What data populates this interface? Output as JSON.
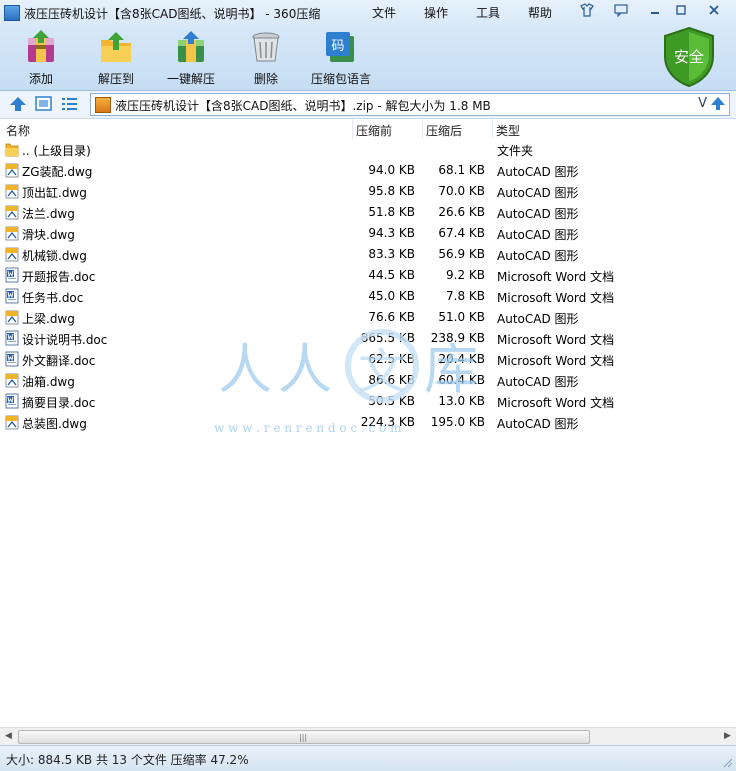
{
  "window": {
    "title": "液压压砖机设计【含8张CAD图纸、说明书】 - 360压缩",
    "menus": [
      "文件",
      "操作",
      "工具",
      "帮助"
    ]
  },
  "toolbar": {
    "items": [
      {
        "label": "添加",
        "icon": "add-archive-icon"
      },
      {
        "label": "解压到",
        "icon": "extract-to-icon"
      },
      {
        "label": "一键解压",
        "icon": "one-click-extract-icon"
      },
      {
        "label": "删除",
        "icon": "delete-icon"
      },
      {
        "label": "压缩包语言",
        "icon": "archive-language-icon",
        "badge": "码"
      }
    ],
    "security_badge": "安全"
  },
  "address": {
    "path": "液压压砖机设计【含8张CAD图纸、说明书】.zip - 解包大小为 1.8 MB",
    "dropdown_glyph": "V"
  },
  "list": {
    "headers": {
      "name": "名称",
      "size": "压缩前",
      "packed": "压缩后",
      "type": "类型"
    },
    "rows": [
      {
        "name": ".. (上级目录)",
        "size": "",
        "packed": "",
        "type": "文件夹",
        "icon": "folder"
      },
      {
        "name": "ZG装配.dwg",
        "size": "94.0 KB",
        "packed": "68.1 KB",
        "type": "AutoCAD 图形",
        "icon": "dwg"
      },
      {
        "name": "顶出缸.dwg",
        "size": "95.8 KB",
        "packed": "70.0 KB",
        "type": "AutoCAD 图形",
        "icon": "dwg"
      },
      {
        "name": "法兰.dwg",
        "size": "51.8 KB",
        "packed": "26.6 KB",
        "type": "AutoCAD 图形",
        "icon": "dwg"
      },
      {
        "name": "滑块.dwg",
        "size": "94.3 KB",
        "packed": "67.4 KB",
        "type": "AutoCAD 图形",
        "icon": "dwg"
      },
      {
        "name": "机械锁.dwg",
        "size": "83.3 KB",
        "packed": "56.9 KB",
        "type": "AutoCAD 图形",
        "icon": "dwg"
      },
      {
        "name": "开题报告.doc",
        "size": "44.5 KB",
        "packed": "9.2 KB",
        "type": "Microsoft Word 文档",
        "icon": "doc"
      },
      {
        "name": "任务书.doc",
        "size": "45.0 KB",
        "packed": "7.8 KB",
        "type": "Microsoft Word 文档",
        "icon": "doc"
      },
      {
        "name": "上梁.dwg",
        "size": "76.6 KB",
        "packed": "51.0 KB",
        "type": "AutoCAD 图形",
        "icon": "dwg"
      },
      {
        "name": "设计说明书.doc",
        "size": "865.5 KB",
        "packed": "238.9 KB",
        "type": "Microsoft Word 文档",
        "icon": "doc"
      },
      {
        "name": "外文翻译.doc",
        "size": "62.5 KB",
        "packed": "20.4 KB",
        "type": "Microsoft Word 文档",
        "icon": "doc"
      },
      {
        "name": "油箱.dwg",
        "size": "86.6 KB",
        "packed": "60.4 KB",
        "type": "AutoCAD 图形",
        "icon": "dwg"
      },
      {
        "name": "摘要目录.doc",
        "size": "50.5 KB",
        "packed": "13.0 KB",
        "type": "Microsoft Word 文档",
        "icon": "doc"
      },
      {
        "name": "总装图.dwg",
        "size": "224.3 KB",
        "packed": "195.0 KB",
        "type": "AutoCAD 图形",
        "icon": "dwg"
      }
    ]
  },
  "watermark": {
    "brand_chars": [
      "人",
      "人",
      "文",
      "库"
    ],
    "url": "w w w . r e n r e n d o c . c o m"
  },
  "statusbar": {
    "text": "大小: 884.5 KB 共 13 个文件 压缩率 47.2%"
  },
  "colors": {
    "accent": "#2e7fd1",
    "shield": "#4aa528",
    "header_band": "#d5e7f7"
  }
}
